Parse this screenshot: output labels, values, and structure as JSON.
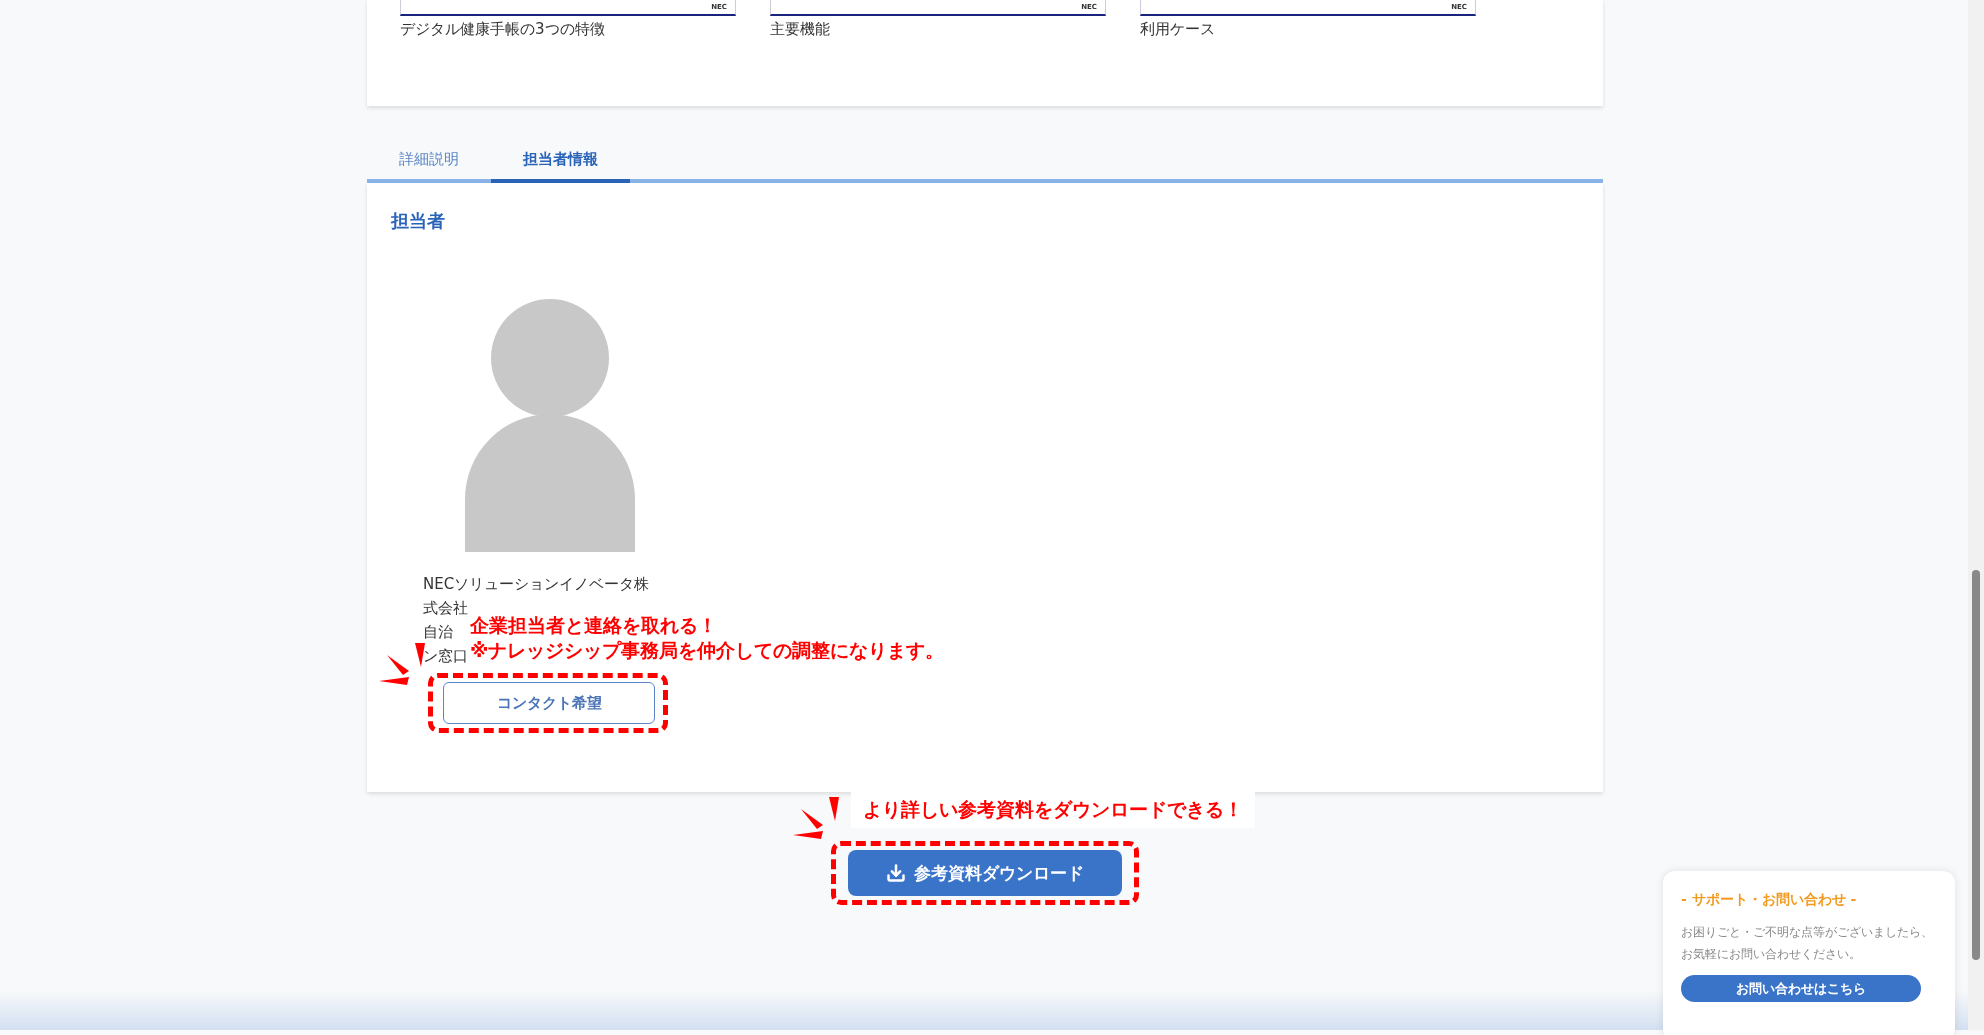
{
  "thumbnails": [
    {
      "caption": "デジタル健康手帳の3つの特徴",
      "logo": "NEC"
    },
    {
      "caption": "主要機能",
      "logo": "NEC"
    },
    {
      "caption": "利用ケース",
      "logo": "NEC"
    }
  ],
  "tabs": [
    {
      "label": "詳細説明",
      "selected": false
    },
    {
      "label": "担当者情報",
      "selected": true
    }
  ],
  "contact": {
    "heading": "担当者",
    "lines": [
      "NECソリューションイノベータ株",
      "式会社",
      "自治",
      "ン窓口"
    ],
    "button": "コンタクト希望"
  },
  "annotations": [
    {
      "lines": [
        "企業担当者と連絡を取れる！",
        "※ナレッジシップ事務局を仲介しての調整になります。"
      ]
    },
    {
      "lines": [
        "より詳しい参考資料をダウンロードできる！"
      ]
    }
  ],
  "download": {
    "label": "参考資料ダウンロード"
  },
  "support": {
    "title": "- サポート・お問い合わせ -",
    "text": "お困りごと・ご不明な点等がございましたら、お気軽にお問い合わせください。",
    "button": "お問い合わせはこちら"
  }
}
